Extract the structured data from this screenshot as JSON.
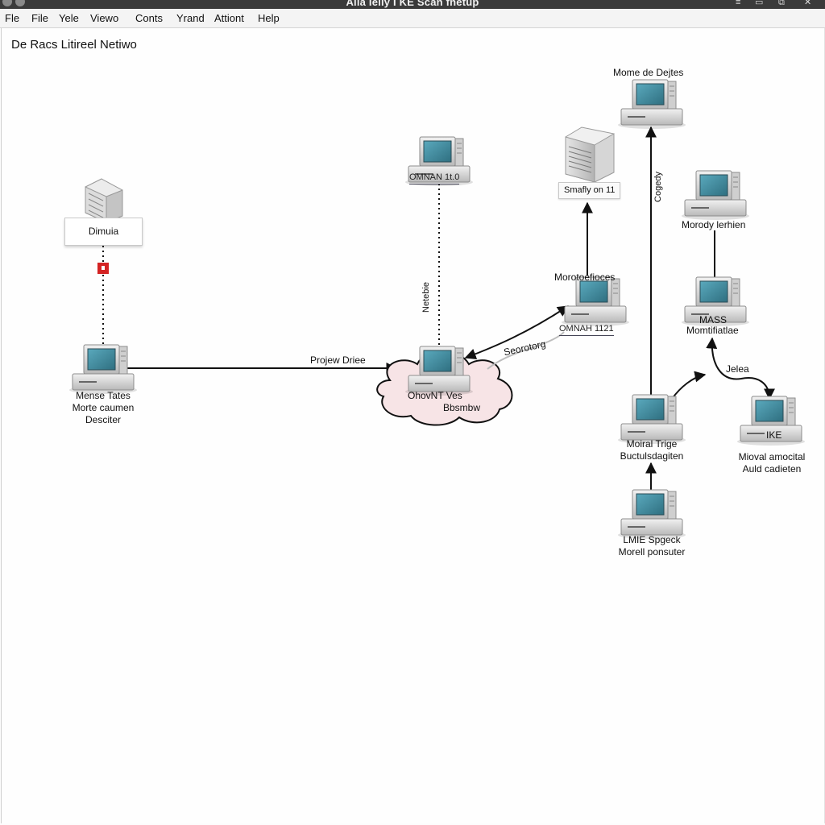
{
  "window": {
    "title": "Alla Ielly I KE Scan fnetup",
    "controls": [
      "≡",
      "▭",
      "⧉",
      "✕"
    ]
  },
  "menu": [
    "Fle",
    "File",
    "Yele",
    "Viewo",
    "Conts",
    "Yrand",
    "Attiont",
    "Help"
  ],
  "page_title": "De Racs Litireel Netiwo",
  "nodes": {
    "dimuia": {
      "label": "Dimuia",
      "icon": "server-rack-icon"
    },
    "left_pc": {
      "line1": "Mense Tates",
      "line2": "Morte caumen",
      "line3": "Desciter",
      "icon": "desktop-computer-icon"
    },
    "omnan_top": {
      "label": "OMNAN 1t.0",
      "icon": "desktop-computer-icon"
    },
    "cloud_pc": {
      "line1": "OhovNT Ves",
      "line2": "Bbsmbw",
      "icon": "desktop-computer-icon"
    },
    "smafly": {
      "label": "Smafly on 11",
      "icon": "server-tower-icon"
    },
    "morotofices": {
      "top": "Morotoefioces",
      "label": "OMNAH 1121",
      "icon": "desktop-computer-icon"
    },
    "mome": {
      "label": "Mome de Dejtes",
      "icon": "desktop-computer-icon"
    },
    "morody": {
      "label": "Morody lerhien",
      "icon": "desktop-computer-icon"
    },
    "mass": {
      "line1": "MASS",
      "line2": "Momtifiatlae",
      "icon": "desktop-computer-icon"
    },
    "moiral": {
      "line1": "Moiral Trige",
      "line2": "Buctulsdagiten",
      "icon": "desktop-computer-icon"
    },
    "ike": {
      "label": "IKE",
      "line1": "Mioval amocital",
      "line2": "Auld cadieten",
      "icon": "desktop-computer-icon"
    },
    "lmie": {
      "line1": "LMIE Spgeck",
      "line2": "Morell ponsuter",
      "icon": "desktop-computer-icon"
    }
  },
  "edges": {
    "projew": "Projew Driee",
    "seorotorg": "Seorotorg",
    "netebie": "Netebie",
    "cogedy": "Cogedy",
    "jelea": "Jelea"
  },
  "colors": {
    "link_line": "#111111",
    "cloud_fill": "#f7e4e6",
    "alert_marker": "#d42323",
    "screen": "#3e8fa3"
  }
}
